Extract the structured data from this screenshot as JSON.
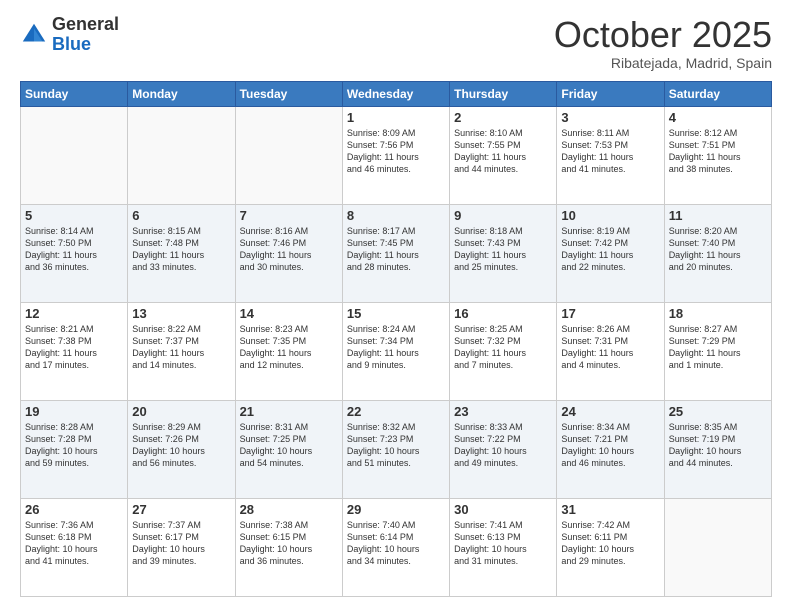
{
  "header": {
    "logo_general": "General",
    "logo_blue": "Blue",
    "month_title": "October 2025",
    "location": "Ribatejada, Madrid, Spain"
  },
  "weekdays": [
    "Sunday",
    "Monday",
    "Tuesday",
    "Wednesday",
    "Thursday",
    "Friday",
    "Saturday"
  ],
  "weeks": [
    [
      {
        "day": "",
        "info": ""
      },
      {
        "day": "",
        "info": ""
      },
      {
        "day": "",
        "info": ""
      },
      {
        "day": "1",
        "info": "Sunrise: 8:09 AM\nSunset: 7:56 PM\nDaylight: 11 hours\nand 46 minutes."
      },
      {
        "day": "2",
        "info": "Sunrise: 8:10 AM\nSunset: 7:55 PM\nDaylight: 11 hours\nand 44 minutes."
      },
      {
        "day": "3",
        "info": "Sunrise: 8:11 AM\nSunset: 7:53 PM\nDaylight: 11 hours\nand 41 minutes."
      },
      {
        "day": "4",
        "info": "Sunrise: 8:12 AM\nSunset: 7:51 PM\nDaylight: 11 hours\nand 38 minutes."
      }
    ],
    [
      {
        "day": "5",
        "info": "Sunrise: 8:14 AM\nSunset: 7:50 PM\nDaylight: 11 hours\nand 36 minutes."
      },
      {
        "day": "6",
        "info": "Sunrise: 8:15 AM\nSunset: 7:48 PM\nDaylight: 11 hours\nand 33 minutes."
      },
      {
        "day": "7",
        "info": "Sunrise: 8:16 AM\nSunset: 7:46 PM\nDaylight: 11 hours\nand 30 minutes."
      },
      {
        "day": "8",
        "info": "Sunrise: 8:17 AM\nSunset: 7:45 PM\nDaylight: 11 hours\nand 28 minutes."
      },
      {
        "day": "9",
        "info": "Sunrise: 8:18 AM\nSunset: 7:43 PM\nDaylight: 11 hours\nand 25 minutes."
      },
      {
        "day": "10",
        "info": "Sunrise: 8:19 AM\nSunset: 7:42 PM\nDaylight: 11 hours\nand 22 minutes."
      },
      {
        "day": "11",
        "info": "Sunrise: 8:20 AM\nSunset: 7:40 PM\nDaylight: 11 hours\nand 20 minutes."
      }
    ],
    [
      {
        "day": "12",
        "info": "Sunrise: 8:21 AM\nSunset: 7:38 PM\nDaylight: 11 hours\nand 17 minutes."
      },
      {
        "day": "13",
        "info": "Sunrise: 8:22 AM\nSunset: 7:37 PM\nDaylight: 11 hours\nand 14 minutes."
      },
      {
        "day": "14",
        "info": "Sunrise: 8:23 AM\nSunset: 7:35 PM\nDaylight: 11 hours\nand 12 minutes."
      },
      {
        "day": "15",
        "info": "Sunrise: 8:24 AM\nSunset: 7:34 PM\nDaylight: 11 hours\nand 9 minutes."
      },
      {
        "day": "16",
        "info": "Sunrise: 8:25 AM\nSunset: 7:32 PM\nDaylight: 11 hours\nand 7 minutes."
      },
      {
        "day": "17",
        "info": "Sunrise: 8:26 AM\nSunset: 7:31 PM\nDaylight: 11 hours\nand 4 minutes."
      },
      {
        "day": "18",
        "info": "Sunrise: 8:27 AM\nSunset: 7:29 PM\nDaylight: 11 hours\nand 1 minute."
      }
    ],
    [
      {
        "day": "19",
        "info": "Sunrise: 8:28 AM\nSunset: 7:28 PM\nDaylight: 10 hours\nand 59 minutes."
      },
      {
        "day": "20",
        "info": "Sunrise: 8:29 AM\nSunset: 7:26 PM\nDaylight: 10 hours\nand 56 minutes."
      },
      {
        "day": "21",
        "info": "Sunrise: 8:31 AM\nSunset: 7:25 PM\nDaylight: 10 hours\nand 54 minutes."
      },
      {
        "day": "22",
        "info": "Sunrise: 8:32 AM\nSunset: 7:23 PM\nDaylight: 10 hours\nand 51 minutes."
      },
      {
        "day": "23",
        "info": "Sunrise: 8:33 AM\nSunset: 7:22 PM\nDaylight: 10 hours\nand 49 minutes."
      },
      {
        "day": "24",
        "info": "Sunrise: 8:34 AM\nSunset: 7:21 PM\nDaylight: 10 hours\nand 46 minutes."
      },
      {
        "day": "25",
        "info": "Sunrise: 8:35 AM\nSunset: 7:19 PM\nDaylight: 10 hours\nand 44 minutes."
      }
    ],
    [
      {
        "day": "26",
        "info": "Sunrise: 7:36 AM\nSunset: 6:18 PM\nDaylight: 10 hours\nand 41 minutes."
      },
      {
        "day": "27",
        "info": "Sunrise: 7:37 AM\nSunset: 6:17 PM\nDaylight: 10 hours\nand 39 minutes."
      },
      {
        "day": "28",
        "info": "Sunrise: 7:38 AM\nSunset: 6:15 PM\nDaylight: 10 hours\nand 36 minutes."
      },
      {
        "day": "29",
        "info": "Sunrise: 7:40 AM\nSunset: 6:14 PM\nDaylight: 10 hours\nand 34 minutes."
      },
      {
        "day": "30",
        "info": "Sunrise: 7:41 AM\nSunset: 6:13 PM\nDaylight: 10 hours\nand 31 minutes."
      },
      {
        "day": "31",
        "info": "Sunrise: 7:42 AM\nSunset: 6:11 PM\nDaylight: 10 hours\nand 29 minutes."
      },
      {
        "day": "",
        "info": ""
      }
    ]
  ]
}
